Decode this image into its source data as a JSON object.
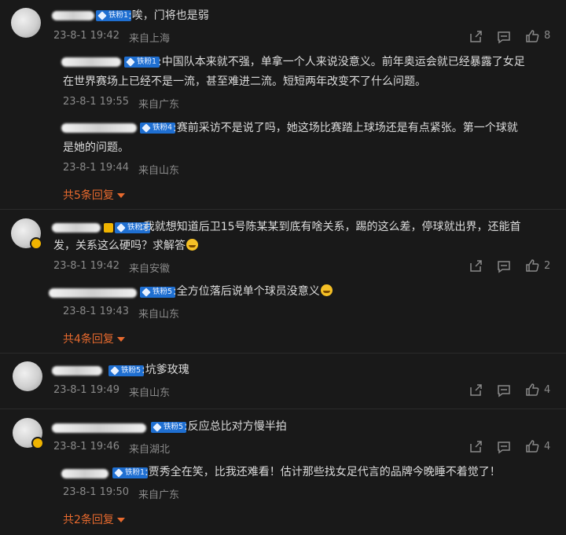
{
  "comments": [
    {
      "tag": "铁粉1",
      "text": ":唉，门将也是弱",
      "date": "23-8-1 19:42",
      "location": "来自上海",
      "likes": "8",
      "replies": [
        {
          "tag": "铁粉1",
          "text_line1": ":中国队本来就不强，单拿一个人来说没意义。前年奥运会就已经暴露了女足",
          "text_line2": "在世界赛场上已经不是一流，甚至难进二流。短短两年改变不了什么问题。",
          "date": "23-8-1 19:55",
          "location": "来自广东"
        },
        {
          "tag": "铁粉4",
          "text_line1": ":赛前采访不是说了吗，她这场比赛踏上球场还是有点紧张。第一个球就",
          "text_line2": "是她的问题。",
          "date": "23-8-1 19:44",
          "location": "来自山东"
        }
      ],
      "more": "共5条回复"
    },
    {
      "tag": "铁粉3",
      "text_line1": ":我就想知道后卫15号陈某某到底有啥关系，踢的这么差，停球就出界，还能首",
      "text_line2": "发，关系这么硬吗？求解答",
      "date": "23-8-1 19:42",
      "location": "来自安徽",
      "likes": "2",
      "replies": [
        {
          "tag": "铁粉5",
          "text_line1": ":全方位落后说单个球员没意义",
          "date": "23-8-1 19:43",
          "location": "来自山东"
        }
      ],
      "more": "共4条回复"
    },
    {
      "tag": "铁粉5",
      "text": ":坑爹玫瑰",
      "date": "23-8-1 19:49",
      "location": "来自山东",
      "likes": "4"
    },
    {
      "tag": "铁粉5",
      "text": ":反应总比对方慢半拍",
      "date": "23-8-1 19:46",
      "location": "来自湖北",
      "likes": "4",
      "replies": [
        {
          "tag": "铁粉1",
          "text_line1": ":贾秀全在笑，比我还难看！估计那些找女足代言的品牌今晚睡不着觉了！",
          "date": "23-8-1 19:50",
          "location": "来自广东"
        }
      ],
      "more": "共2条回复"
    }
  ]
}
